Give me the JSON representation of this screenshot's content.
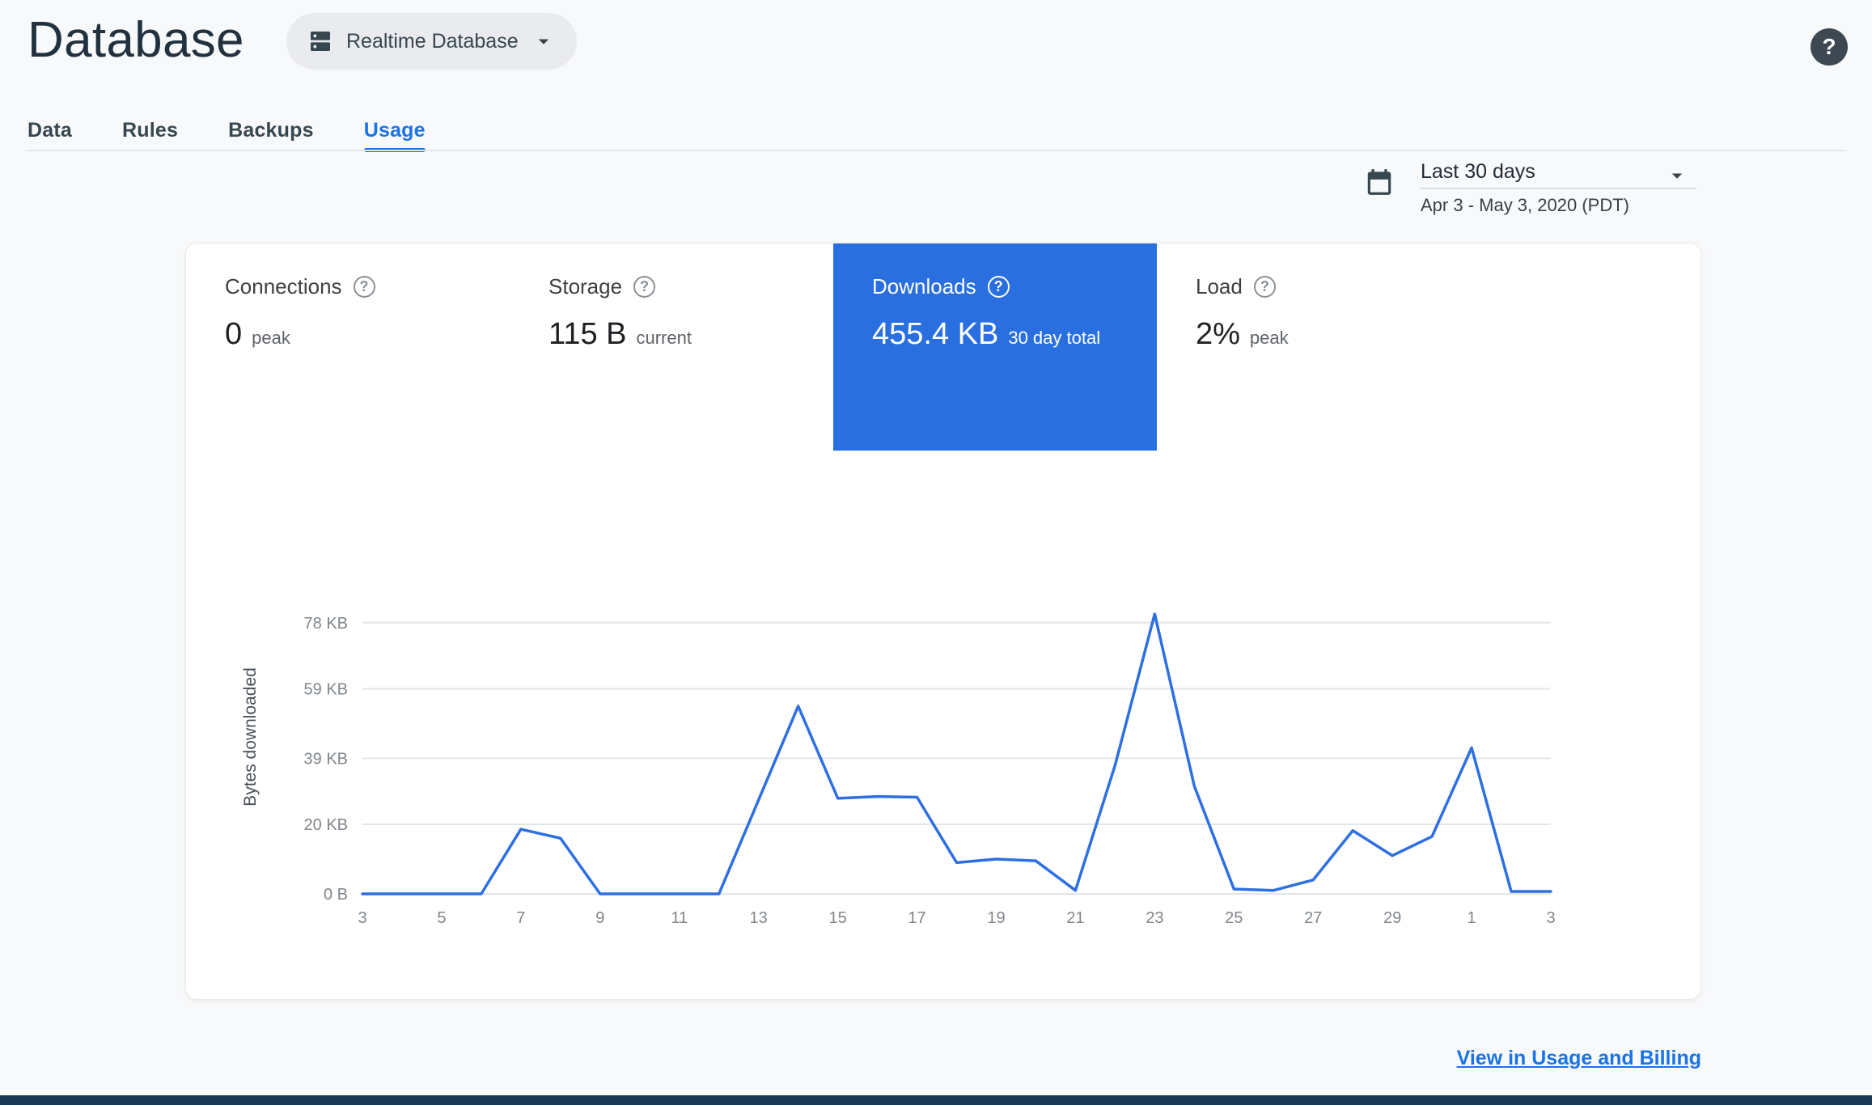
{
  "header": {
    "title": "Database",
    "db_selector_label": "Realtime Database"
  },
  "tabs": [
    {
      "label": "Data"
    },
    {
      "label": "Rules"
    },
    {
      "label": "Backups"
    },
    {
      "label": "Usage"
    }
  ],
  "active_tab": "Usage",
  "date_range": {
    "selected": "Last 30 days",
    "detail": "Apr 3 - May 3, 2020 (PDT)"
  },
  "metrics": [
    {
      "title": "Connections",
      "value": "0",
      "qualifier": "peak",
      "selected": false
    },
    {
      "title": "Storage",
      "value": "115 B",
      "qualifier": "current",
      "selected": false
    },
    {
      "title": "Downloads",
      "value": "455.4 KB",
      "qualifier": "30 day total",
      "selected": true
    },
    {
      "title": "Load",
      "value": "2%",
      "qualifier": "peak",
      "selected": false
    }
  ],
  "chart_data": {
    "type": "line",
    "ylabel": "Bytes downloaded",
    "x_days": [
      3,
      4,
      5,
      6,
      7,
      8,
      9,
      10,
      11,
      12,
      13,
      14,
      15,
      16,
      17,
      18,
      19,
      20,
      21,
      22,
      23,
      24,
      25,
      26,
      27,
      28,
      29,
      30,
      1,
      2,
      3
    ],
    "x_tick_labels": [
      "3",
      "5",
      "7",
      "9",
      "11",
      "13",
      "15",
      "17",
      "19",
      "21",
      "23",
      "25",
      "27",
      "29",
      "1",
      "3"
    ],
    "values_kb": [
      0,
      0,
      0,
      0,
      18.6,
      16,
      0,
      0,
      0,
      0,
      27,
      54,
      27.5,
      28,
      27.8,
      9,
      10,
      9.5,
      1,
      37,
      80.5,
      31,
      1.4,
      1,
      4,
      18.2,
      11,
      16.5,
      42,
      0.7,
      0.7
    ],
    "y_ticks": [
      {
        "kb": 0,
        "label": "0 B"
      },
      {
        "kb": 20,
        "label": "20 KB"
      },
      {
        "kb": 39,
        "label": "39 KB"
      },
      {
        "kb": 59,
        "label": "59 KB"
      },
      {
        "kb": 78,
        "label": "78 KB"
      }
    ],
    "ylim": [
      0,
      84.7
    ],
    "grid": true,
    "legend": "none",
    "line_color": "#2e6fe2"
  },
  "footer": {
    "link_label": "View in Usage and Billing"
  },
  "colors": {
    "accent_blue": "#1a73e8",
    "selected_tile_blue": "#2a6fe0",
    "chart_line_blue": "#2e6fe2",
    "pill_gray": "#e9ebef",
    "header_text": "#22313f",
    "page_bg": "#f8f9fa",
    "grid_line": "#e2e5e8",
    "bottom_bar": "#1b3a57"
  }
}
